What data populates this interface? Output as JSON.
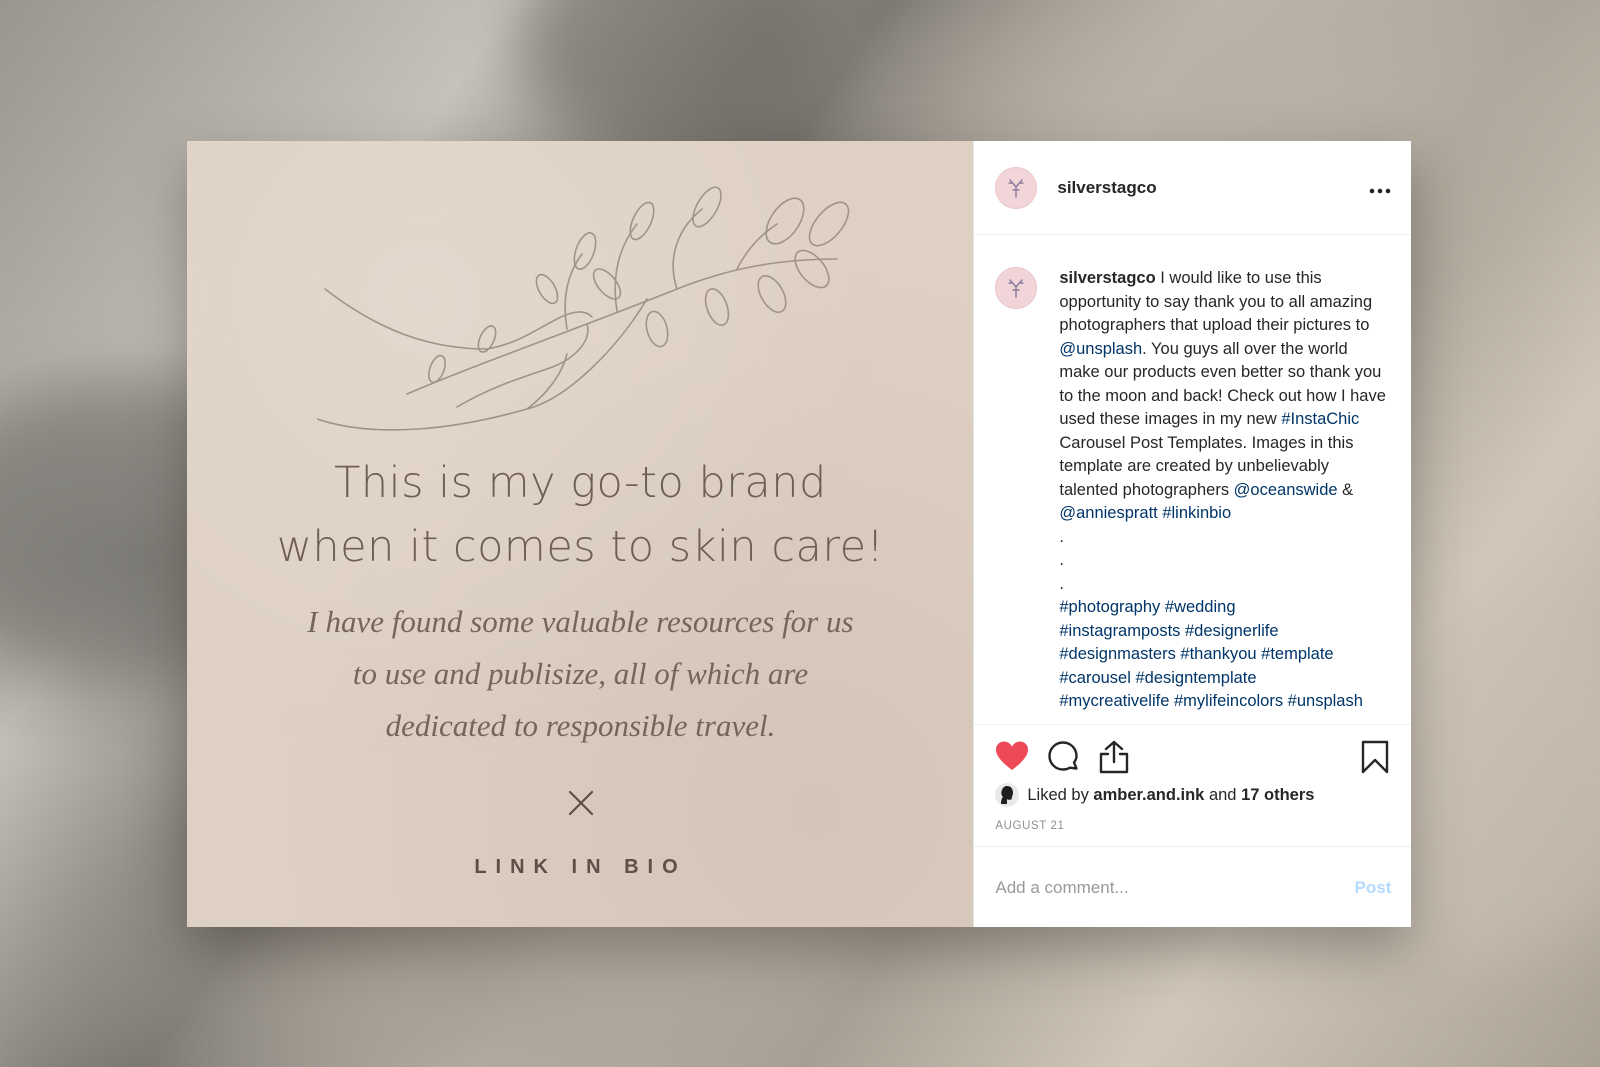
{
  "media": {
    "headline_line1": "This is my go-to brand",
    "headline_line2": "when it comes to skin care!",
    "subline_line1": "I have found some valuable resources for us",
    "subline_line2": "to use and publisize, all of which are",
    "subline_line3": "dedicated to responsible travel.",
    "cta": "LINK IN BIO",
    "background_color": "#ded0c3"
  },
  "header": {
    "username": "silverstagco",
    "more_icon": "ellipsis-icon"
  },
  "caption": {
    "username": "silverstagco",
    "text1": " I would like to use this opportunity to say thank you to all amazing photographers that upload their pictures to ",
    "mention1": "@unsplash",
    "text2": ". You guys all over the world make our products even better so thank you to the moon and back! Check out how I have used these images in my new ",
    "tag1": "#InstaChic",
    "text3": " Carousel Post Templates. Images in this template are created by unbelievably talented photographers ",
    "mention2": "@oceanswide",
    "text4": " & ",
    "mention3": "@anniespratt",
    "tag2": "#linkinbio",
    "dot": ".",
    "hashtags_line1": "#photography #wedding",
    "hashtags_line2": "#instagramposts #designerlife",
    "hashtags_line3": "#designmasters #thankyou #template",
    "hashtags_line4": "#carousel #designtemplate",
    "hashtags_line5": "#mycreativelife #mylifeincolors #unsplash"
  },
  "actions": {
    "like_icon": "heart-icon",
    "comment_icon": "comment-icon",
    "share_icon": "share-icon",
    "save_icon": "bookmark-icon",
    "liked_prefix": "Liked by ",
    "liked_user": "amber.and.ink",
    "liked_mid": " and ",
    "liked_others": "17 others",
    "date": "AUGUST 21"
  },
  "comment": {
    "placeholder": "Add a comment...",
    "post_label": "Post"
  },
  "colors": {
    "like": "#ed4956",
    "link": "#003569",
    "post_disabled": "#b3dbff"
  }
}
